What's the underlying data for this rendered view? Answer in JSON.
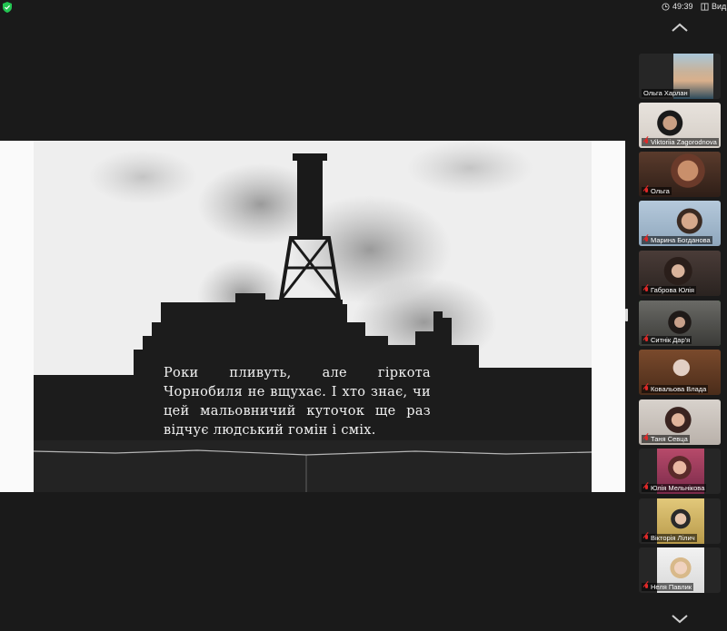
{
  "topbar": {
    "timer": "49:39",
    "view_label": "Вид",
    "icons": [
      "shield-check-icon",
      "clock-icon",
      "grid-view-icon"
    ],
    "colors": {
      "shield": "#23c552"
    }
  },
  "slide": {
    "caption": "Роки пливуть, але гіркота Чорнобиля не вщухає. І хто знає, чи цей мальовничий куточок ще раз відчує людський гомін і сміх."
  },
  "participants": [
    {
      "name": "Ольга Харлан",
      "muted": false,
      "active": false
    },
    {
      "name": "Viktoriia Zagorodnova",
      "muted": true,
      "active": false
    },
    {
      "name": "Ольга",
      "muted": true,
      "active": false
    },
    {
      "name": "Марина  Богданова",
      "muted": true,
      "active": false
    },
    {
      "name": "Габрова Юлія",
      "muted": true,
      "active": false
    },
    {
      "name": "Ситнік Дар'я",
      "muted": true,
      "active": true
    },
    {
      "name": "Ковальова Влада",
      "muted": true,
      "active": false
    },
    {
      "name": "Таня Севца",
      "muted": true,
      "active": false
    },
    {
      "name": "Юлія Мельнікова",
      "muted": true,
      "active": false
    },
    {
      "name": "Вікторія Лілич",
      "muted": true,
      "active": false
    },
    {
      "name": "Неля Павлик",
      "muted": true,
      "active": false
    }
  ],
  "colors": {
    "active_border": "#3fbf4a",
    "muted_mic": "#e02828"
  }
}
